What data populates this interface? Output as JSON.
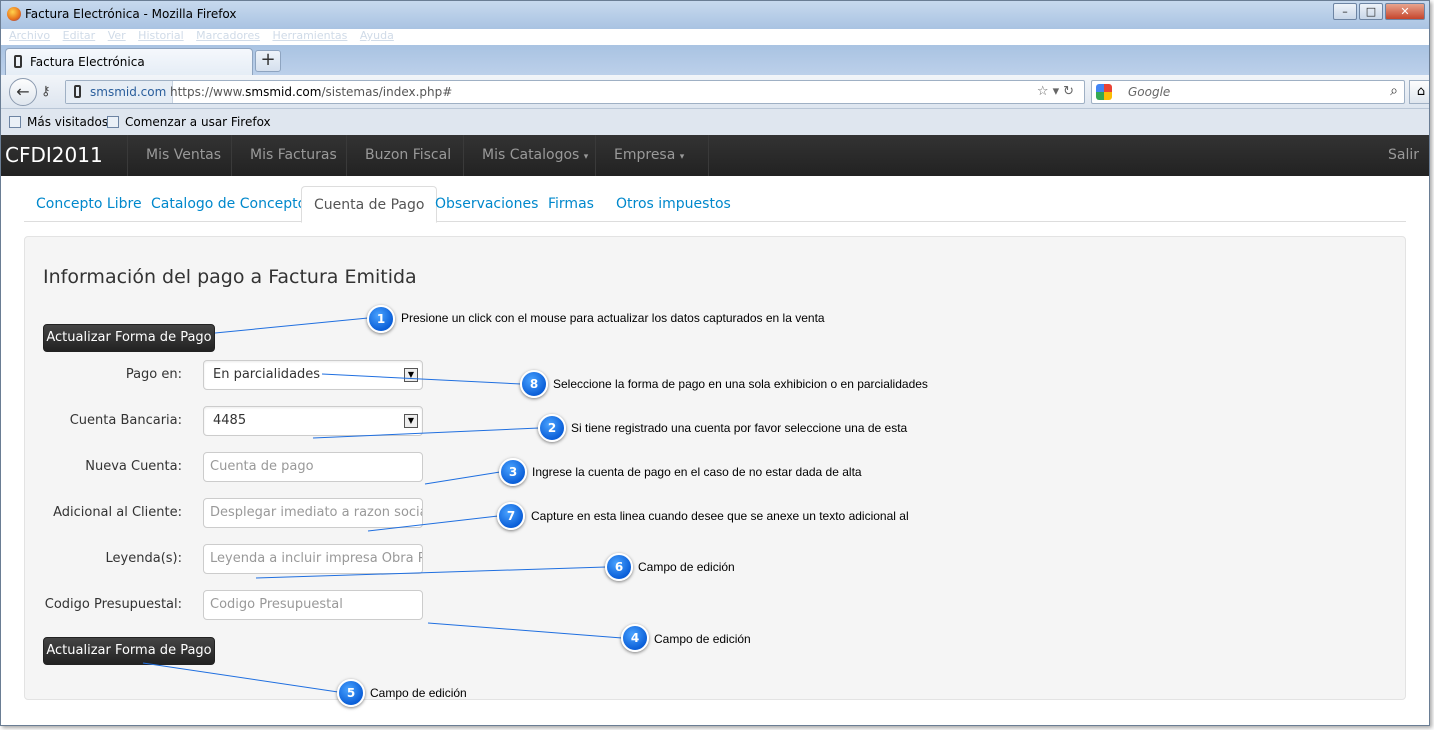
{
  "browser": {
    "window_title": "Factura Electrónica - Mozilla Firefox",
    "menu": [
      "Archivo",
      "Editar",
      "Ver",
      "Historial",
      "Marcadores",
      "Herramientas",
      "Ayuda"
    ],
    "tab_label": "Factura Electrónica",
    "site_identity": "smsmid.com",
    "url_prefix": "https://www.",
    "url_domain": "smsmid.com",
    "url_path": "/sistemas/index.php#",
    "search_placeholder": "Google",
    "bookmarks": [
      "Más visitados",
      "Comenzar a usar Firefox"
    ]
  },
  "app": {
    "brand": "CFDI2011",
    "nav": [
      "Mis Ventas",
      "Mis Facturas",
      "Buzon Fiscal",
      "Mis Catalogos",
      "Empresa"
    ],
    "logout": "Salir"
  },
  "tabs": [
    "Concepto Libre",
    "Catalogo de Conceptos",
    "Cuenta de Pago",
    "Observaciones",
    "Firmas",
    "Otros impuestos"
  ],
  "active_tab": "Cuenta de Pago",
  "form": {
    "title": "Información del pago a Factura Emitida",
    "submit_label": "Actualizar Forma de Pago",
    "fields": {
      "pago_en": {
        "label": "Pago en:",
        "value": "En parcialidades"
      },
      "cuenta_bancaria": {
        "label": "Cuenta Bancaria:",
        "value": "4485"
      },
      "nueva_cuenta": {
        "label": "Nueva Cuenta:",
        "placeholder": "Cuenta de pago"
      },
      "adicional_cliente": {
        "label": "Adicional al Cliente:",
        "placeholder": "Desplegar imediato a razon social"
      },
      "leyendas": {
        "label": "Leyenda(s):",
        "placeholder": "Leyenda a incluir impresa Obra Públ"
      },
      "codigo_presupuestal": {
        "label": "Codigo Presupuestal:",
        "placeholder": "Codigo Presupuestal"
      }
    }
  },
  "callouts": [
    {
      "number": "1",
      "text": "Presione un click con el mouse para actualizar los datos capturados en la venta"
    },
    {
      "number": "8",
      "text": "Seleccione la forma de pago en una sola exhibicion o en parcialidades"
    },
    {
      "number": "2",
      "text": "Si tiene registrado una cuenta por favor seleccione una de esta"
    },
    {
      "number": "3",
      "text": "Ingrese la cuenta de pago en el caso de no estar dada de alta"
    },
    {
      "number": "7",
      "text": "Capture en esta linea cuando desee que se anexe un texto adicional al"
    },
    {
      "number": "6",
      "text": "Campo de edición"
    },
    {
      "number": "4",
      "text": "Campo de edición"
    },
    {
      "number": "5",
      "text": "Campo de edición"
    }
  ],
  "colors": {
    "callout_blue": "#0b5fd8",
    "link": "#0088cc",
    "navbar": "#222222"
  }
}
